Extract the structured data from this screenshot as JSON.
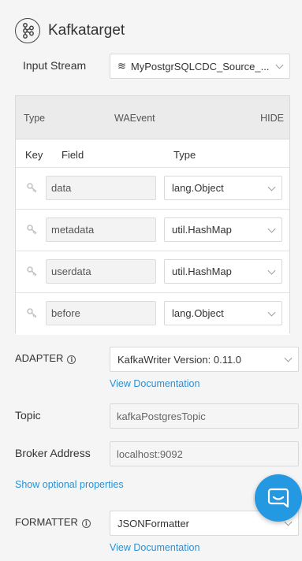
{
  "header": {
    "title": "Kafkatarget",
    "icon": "kafka-nodes-icon"
  },
  "input_stream": {
    "label": "Input Stream",
    "value": "MyPostgrSQLCDC_Source_...",
    "stream_icon": "≋"
  },
  "type_panel": {
    "type_label": "Type",
    "type_value": "WAEvent",
    "hide_label": "HIDE",
    "columns": {
      "key": "Key",
      "field": "Field",
      "type": "Type"
    },
    "rows": [
      {
        "field": "data",
        "type": "lang.Object"
      },
      {
        "field": "metadata",
        "type": "util.HashMap"
      },
      {
        "field": "userdata",
        "type": "util.HashMap"
      },
      {
        "field": "before",
        "type": "lang.Object"
      }
    ]
  },
  "adapter": {
    "label": "ADAPTER",
    "value": "KafkaWriter Version: 0.11.0",
    "doc_link": "View Documentation"
  },
  "topic": {
    "label": "Topic",
    "value": "kafkaPostgresTopic"
  },
  "broker": {
    "label": "Broker Address",
    "value": "localhost:9092"
  },
  "optional_link": "Show optional properties",
  "formatter": {
    "label": "FORMATTER",
    "value": "JSONFormatter",
    "doc_link": "View Documentation"
  },
  "info_glyph": "i",
  "colors": {
    "link": "#2f8fcf",
    "chat": "#2498e0",
    "background": "#f5f5f5"
  }
}
